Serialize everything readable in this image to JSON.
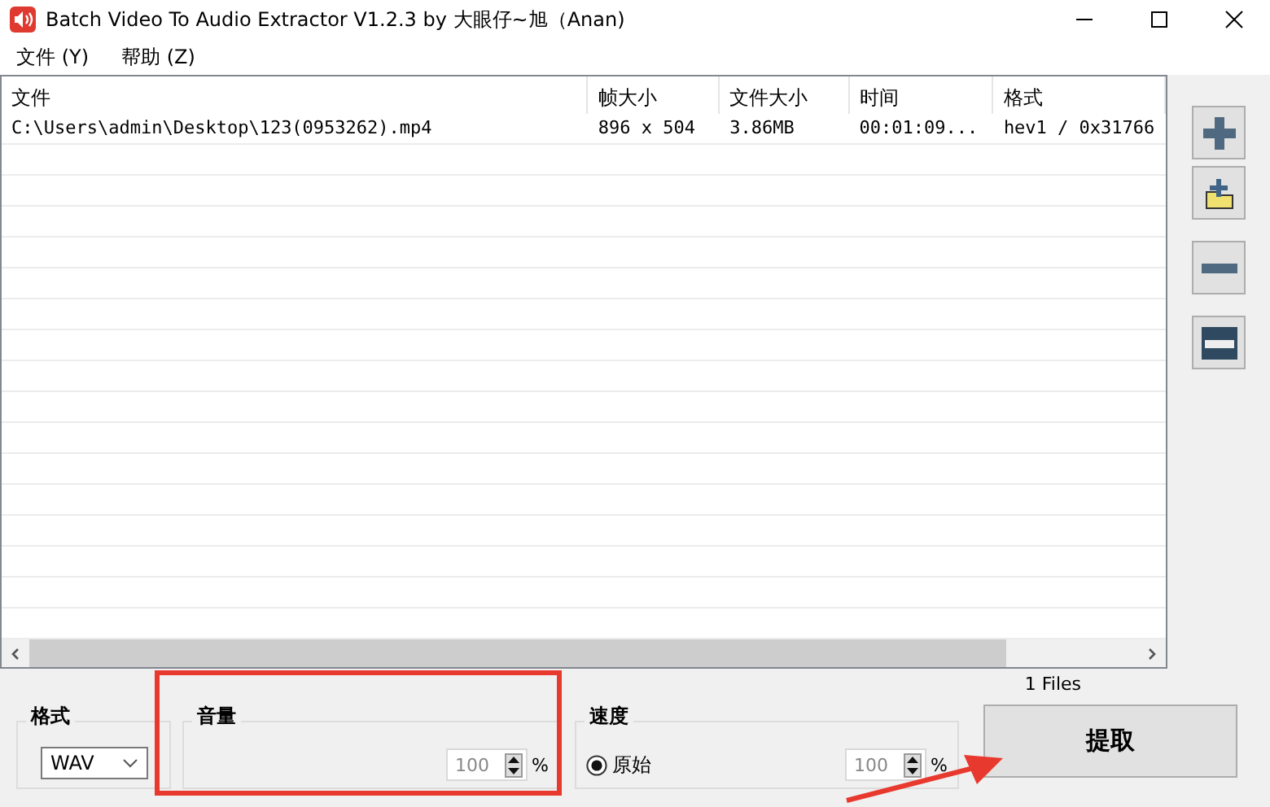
{
  "window": {
    "title": "Batch Video To Audio Extractor V1.2.3 by 大眼仔~旭（Anan)"
  },
  "menu": [
    {
      "label": "文件 (Y)"
    },
    {
      "label": "帮助 (Z)"
    }
  ],
  "table": {
    "columns": [
      "文件",
      "帧大小",
      "文件大小",
      "时间",
      "格式"
    ],
    "rows": [
      [
        "C:\\Users\\admin\\Desktop\\123(0953262).mp4",
        "896 x 504",
        "3.86MB",
        "00:01:09...",
        "hev1 / 0x31766"
      ]
    ]
  },
  "side_buttons": [
    {
      "kind": "add"
    },
    {
      "kind": "add-folder"
    },
    {
      "kind": "remove"
    },
    {
      "kind": "clear"
    }
  ],
  "file_count": "1 Files",
  "format": {
    "label": "格式",
    "value": "WAV"
  },
  "volume": {
    "label": "音量",
    "value": "100",
    "unit": "%"
  },
  "speed": {
    "label": "速度",
    "option": {
      "label": "原始",
      "selected": true
    },
    "value": "100",
    "unit": "%"
  },
  "extract_button": "提取"
}
